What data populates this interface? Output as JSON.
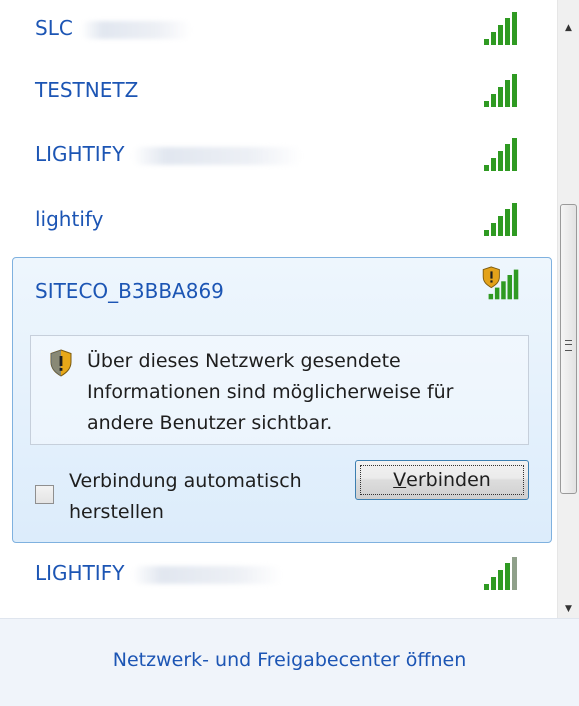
{
  "networks": [
    {
      "name": "SLC",
      "icon": "signal-bars-icon",
      "security_warning": false
    },
    {
      "name": "TESTNETZ",
      "icon": "signal-bars-icon",
      "security_warning": false
    },
    {
      "name": "LIGHTIFY",
      "icon": "signal-bars-icon",
      "security_warning": false
    },
    {
      "name": "lightify",
      "icon": "signal-bars-icon",
      "security_warning": false
    },
    {
      "name": "SITECO_B3BBA869",
      "icon": "signal-bars-shield-icon",
      "security_warning": true,
      "selected": true
    },
    {
      "name": "LIGHTIFY",
      "icon": "signal-bars-icon",
      "security_warning": false
    }
  ],
  "selected_panel": {
    "warning_text": "Über dieses Netzwerk gesendete Informationen sind möglicherweise für andere Benutzer sichtbar.",
    "auto_connect_label": "Verbindung automatisch herstellen",
    "auto_connect_checked": false,
    "connect_mnemonic": "V",
    "connect_rest": "erbinden"
  },
  "footer": {
    "link_label": "Netzwerk- und Freigabecenter öffnen"
  },
  "colors": {
    "link_blue": "#1c55b4",
    "signal_green": "#2f9a22",
    "selected_border": "#7fb1df",
    "selected_bg": "#e4f0fc"
  }
}
